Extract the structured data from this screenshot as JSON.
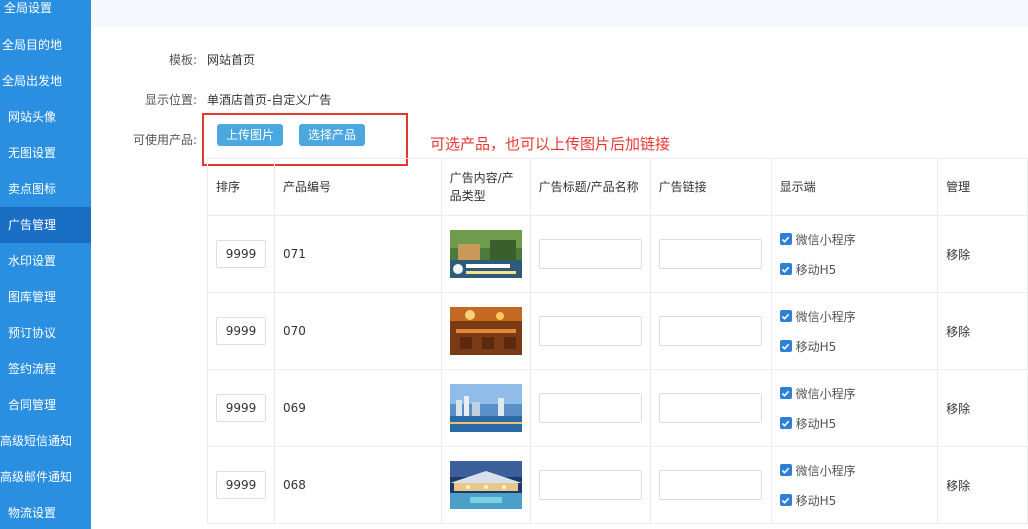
{
  "sidebar": {
    "items": [
      {
        "label": "全局设置",
        "active": false
      },
      {
        "label": "全局目的地",
        "active": false
      },
      {
        "label": "全局出发地",
        "active": false
      },
      {
        "label": "网站头像",
        "active": false
      },
      {
        "label": "无图设置",
        "active": false
      },
      {
        "label": "卖点图标",
        "active": false
      },
      {
        "label": "广告管理",
        "active": true
      },
      {
        "label": "水印设置",
        "active": false
      },
      {
        "label": "图库管理",
        "active": false
      },
      {
        "label": "预订协议",
        "active": false
      },
      {
        "label": "签约流程",
        "active": false
      },
      {
        "label": "合同管理",
        "active": false
      },
      {
        "label": "高级短信通知",
        "active": false
      },
      {
        "label": "高级邮件通知",
        "active": false
      },
      {
        "label": "物流设置",
        "active": false
      }
    ]
  },
  "form": {
    "template_label": "模板:",
    "template_value": "网站首页",
    "position_label": "显示位置:",
    "position_value": "单酒店首页-自定义广告",
    "products_label": "可使用产品:",
    "upload_button": "上传图片",
    "select_button": "选择产品"
  },
  "annotation": {
    "text": "可选产品，也可以上传图片后加链接",
    "color": "#e8372f"
  },
  "table": {
    "headers": {
      "sort": "排序",
      "code": "产品编号",
      "content_line1": "广告内容/产",
      "content_line2": "品类型",
      "title": "广告标题/产品名称",
      "link": "广告链接",
      "display": "显示端",
      "manage": "管理"
    },
    "rows": [
      {
        "sort": "9999",
        "code": "071",
        "check1": "微信小程序",
        "check2": "移动H5",
        "action": "移除"
      },
      {
        "sort": "9999",
        "code": "070",
        "check1": "微信小程序",
        "check2": "移动H5",
        "action": "移除"
      },
      {
        "sort": "9999",
        "code": "069",
        "check1": "微信小程序",
        "check2": "移动H5",
        "action": "移除"
      },
      {
        "sort": "9999",
        "code": "068",
        "check1": "微信小程序",
        "check2": "移动H5",
        "action": "移除"
      }
    ]
  },
  "colors": {
    "sidebar": "#2a8fe0",
    "sidebar_active": "#1a6fc4",
    "button": "#4aa7e0",
    "checkbox": "#2f7fd6"
  }
}
